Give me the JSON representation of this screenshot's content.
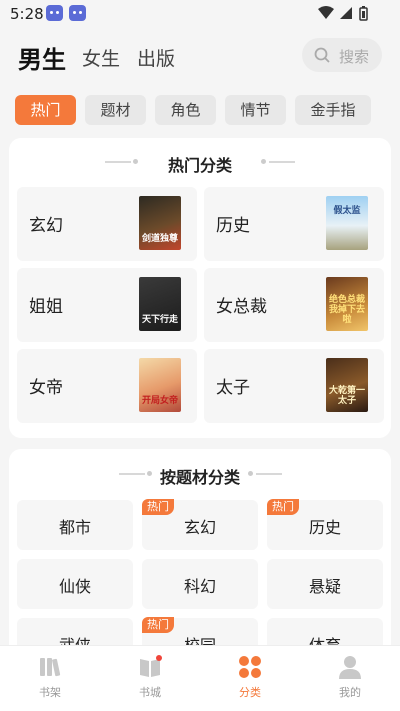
{
  "status": {
    "time": "5:28"
  },
  "header": {
    "tabs": [
      {
        "label": "男生",
        "active": true
      },
      {
        "label": "女生",
        "active": false
      },
      {
        "label": "出版",
        "active": false
      }
    ],
    "search_placeholder": "搜索"
  },
  "filters": [
    {
      "label": "热门",
      "active": true
    },
    {
      "label": "题材",
      "active": false
    },
    {
      "label": "角色",
      "active": false
    },
    {
      "label": "情节",
      "active": false
    },
    {
      "label": "金手指",
      "active": false
    }
  ],
  "hot_section": {
    "title": "热门分类",
    "items": [
      {
        "label": "玄幻",
        "cover_text": "剑道独尊"
      },
      {
        "label": "历史",
        "cover_text": "假太监"
      },
      {
        "label": "姐姐",
        "cover_text": "天下行走"
      },
      {
        "label": "女总裁",
        "cover_text": "绝色总裁我掉下去啦"
      },
      {
        "label": "女帝",
        "cover_text": "开局女帝"
      },
      {
        "label": "太子",
        "cover_text": "大乾第一太子"
      }
    ]
  },
  "topic_section": {
    "title": "按题材分类",
    "hot_badge": "热门",
    "items": [
      {
        "label": "都市",
        "hot": false
      },
      {
        "label": "玄幻",
        "hot": true
      },
      {
        "label": "历史",
        "hot": true
      },
      {
        "label": "仙侠",
        "hot": false
      },
      {
        "label": "科幻",
        "hot": false
      },
      {
        "label": "悬疑",
        "hot": false
      },
      {
        "label": "武侠",
        "hot": false
      },
      {
        "label": "校园",
        "hot": true
      },
      {
        "label": "体育",
        "hot": false
      }
    ]
  },
  "bottom_nav": [
    {
      "label": "书架",
      "icon": "bookshelf-icon",
      "active": false
    },
    {
      "label": "书城",
      "icon": "bookstore-icon",
      "active": false
    },
    {
      "label": "分类",
      "icon": "category-icon",
      "active": true
    },
    {
      "label": "我的",
      "icon": "profile-icon",
      "active": false
    }
  ],
  "colors": {
    "accent": "#f4793b"
  }
}
